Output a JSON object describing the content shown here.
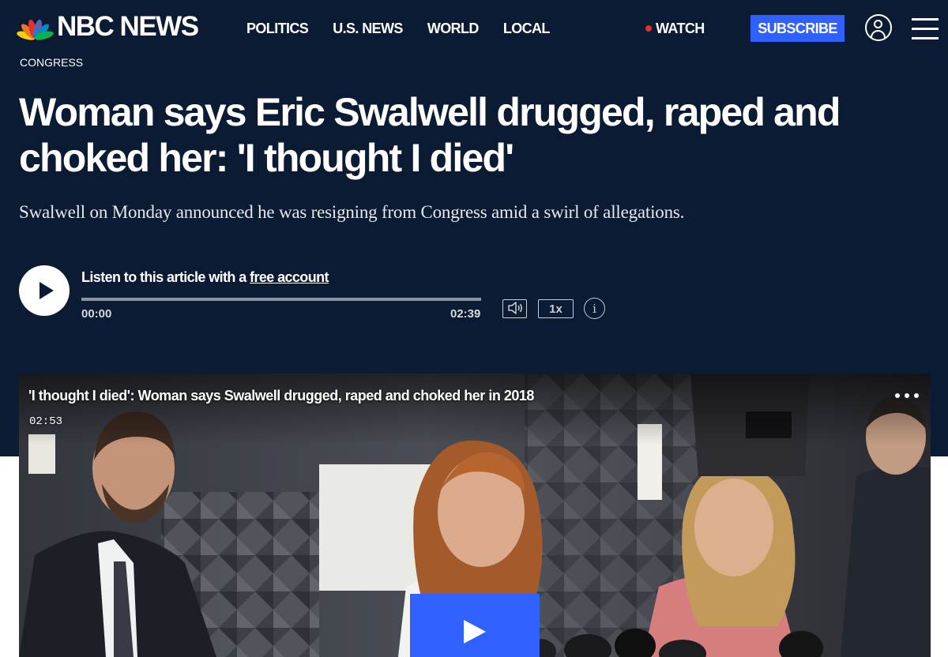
{
  "brand": {
    "name": "NBC NEWS"
  },
  "nav": [
    {
      "label": "POLITICS"
    },
    {
      "label": "U.S. NEWS"
    },
    {
      "label": "WORLD"
    },
    {
      "label": "LOCAL"
    }
  ],
  "header": {
    "watch_label": "WATCH",
    "subscribe_label": "SUBSCRIBE",
    "account_icon": "user-circle-icon",
    "menu_icon": "hamburger-menu-icon"
  },
  "article": {
    "section": "CONGRESS",
    "headline": "Woman says Eric Swalwell drugged, raped and choked her: 'I thought I died'",
    "dek": "Swalwell on Monday announced he was resigning from Congress amid a swirl of allegations."
  },
  "audio": {
    "prompt_text": "Listen to this article with a ",
    "link_text": "free account",
    "current_time": "00:00",
    "duration": "02:39",
    "progress": 0,
    "speed_label": "1x",
    "info_label": "i"
  },
  "video": {
    "title": "'I thought I died': Woman says Swalwell drugged, raped and choked her in 2018",
    "duration": "02:53"
  },
  "colors": {
    "background": "#0b1b33",
    "subscribe": "#3061ff",
    "live_dot": "#e4312b",
    "lower_band": "#ffffff"
  }
}
